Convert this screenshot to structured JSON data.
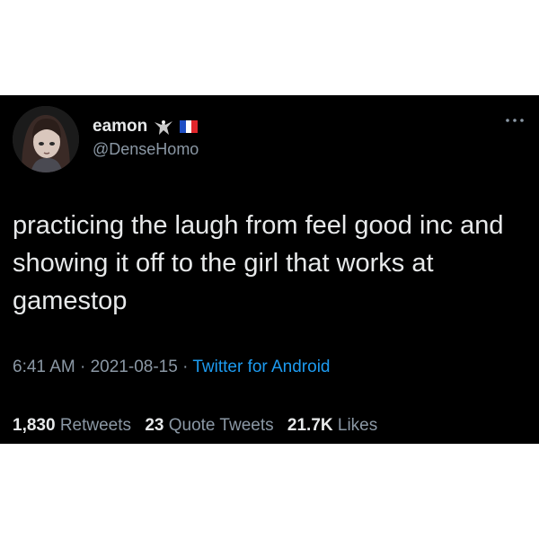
{
  "user": {
    "display_name": "eamon",
    "handle": "@DenseHomo",
    "emoji_icons": [
      "eagle-icon",
      "france-flag-icon"
    ],
    "avatar": "anime-girl-avatar"
  },
  "tweet": {
    "text": "practicing the laugh from feel good inc and showing it off to the girl that works at gamestop",
    "time": "6:41 AM",
    "date": "2021-08-15",
    "separator": "·",
    "source": "Twitter for Android"
  },
  "stats": {
    "retweets_count": "1,830",
    "retweets_label": "Retweets",
    "quotes_count": "23",
    "quotes_label": "Quote Tweets",
    "likes_count": "21.7K",
    "likes_label": "Likes"
  },
  "colors": {
    "background": "#000000",
    "text": "#e7e9ea",
    "muted": "#8b98a5",
    "link": "#1d9bf0"
  }
}
